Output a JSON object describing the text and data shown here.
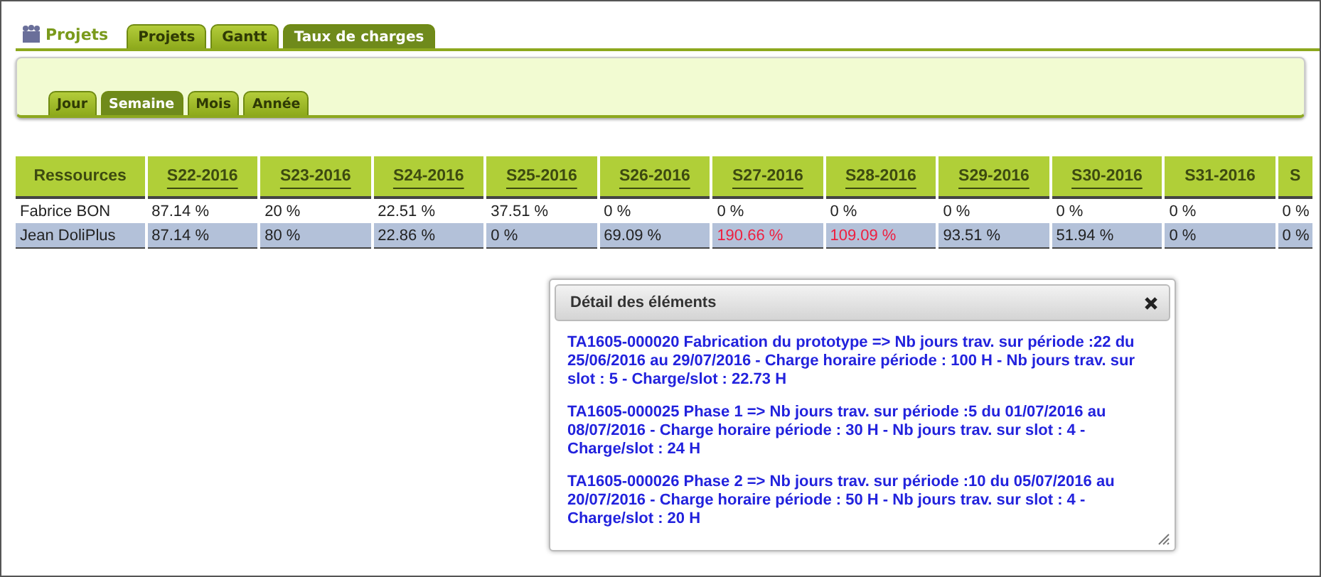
{
  "module": {
    "title": "Projets"
  },
  "tabs": [
    {
      "label": "Projets",
      "selected": false
    },
    {
      "label": "Gantt",
      "selected": false
    },
    {
      "label": "Taux de charges",
      "selected": true
    }
  ],
  "subtabs": [
    {
      "label": "Jour",
      "selected": false
    },
    {
      "label": "Semaine",
      "selected": true
    },
    {
      "label": "Mois",
      "selected": false
    },
    {
      "label": "Année",
      "selected": false
    }
  ],
  "table": {
    "columns": [
      {
        "label": "Ressources",
        "link": false
      },
      {
        "label": "S22-2016",
        "link": true
      },
      {
        "label": "S23-2016",
        "link": true
      },
      {
        "label": "S24-2016",
        "link": true
      },
      {
        "label": "S25-2016",
        "link": true
      },
      {
        "label": "S26-2016",
        "link": true
      },
      {
        "label": "S27-2016",
        "link": true
      },
      {
        "label": "S28-2016",
        "link": true
      },
      {
        "label": "S29-2016",
        "link": true
      },
      {
        "label": "S30-2016",
        "link": true
      },
      {
        "label": "S31-2016",
        "link": false
      },
      {
        "label": "S",
        "link": false
      }
    ],
    "rows": [
      {
        "selected": false,
        "cells": [
          {
            "text": "Fabrice BON",
            "over": false
          },
          {
            "text": "87.14 %",
            "over": false
          },
          {
            "text": "20 %",
            "over": false
          },
          {
            "text": "22.51 %",
            "over": false
          },
          {
            "text": "37.51 %",
            "over": false
          },
          {
            "text": "0 %",
            "over": false
          },
          {
            "text": "0 %",
            "over": false
          },
          {
            "text": "0 %",
            "over": false
          },
          {
            "text": "0 %",
            "over": false
          },
          {
            "text": "0 %",
            "over": false
          },
          {
            "text": "0 %",
            "over": false
          },
          {
            "text": "0 %",
            "over": false
          }
        ]
      },
      {
        "selected": true,
        "cells": [
          {
            "text": "Jean DoliPlus",
            "over": false
          },
          {
            "text": "87.14 %",
            "over": false
          },
          {
            "text": "80 %",
            "over": false
          },
          {
            "text": "22.86 %",
            "over": false
          },
          {
            "text": "0 %",
            "over": false
          },
          {
            "text": "69.09 %",
            "over": false
          },
          {
            "text": "190.66 %",
            "over": true
          },
          {
            "text": "109.09 %",
            "over": true
          },
          {
            "text": "93.51 %",
            "over": false
          },
          {
            "text": "51.94 %",
            "over": false
          },
          {
            "text": "0 %",
            "over": false
          },
          {
            "text": "0 %",
            "over": false
          }
        ]
      }
    ]
  },
  "dialog": {
    "title": "Détail des éléments",
    "items": [
      "TA1605-000020 Fabrication du prototype => Nb jours trav. sur période :22 du 25/06/2016 au 29/07/2016 - Charge horaire période : 100 H - Nb jours trav. sur slot : 5 - Charge/slot : 22.73 H",
      "TA1605-000025 Phase 1 => Nb jours trav. sur période :5 du 01/07/2016 au 08/07/2016 - Charge horaire période : 30 H - Nb jours trav. sur slot : 4 - Charge/slot : 24 H",
      "TA1605-000026 Phase 2 => Nb jours trav. sur période :10 du 05/07/2016 au 20/07/2016 - Charge horaire période : 50 H - Nb jours trav. sur slot : 4 - Charge/slot : 20 H"
    ]
  }
}
